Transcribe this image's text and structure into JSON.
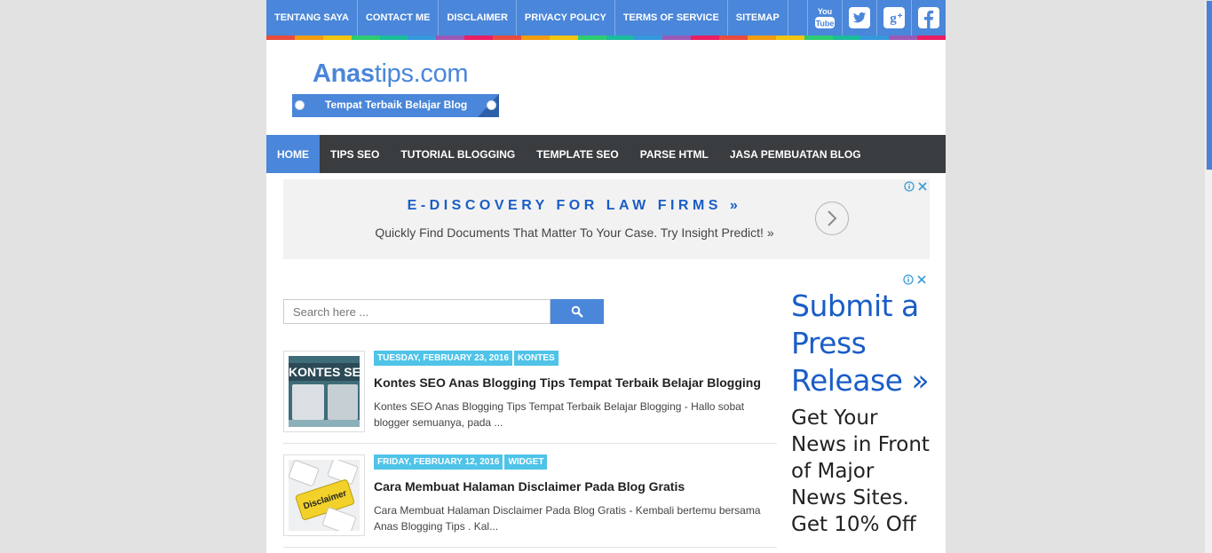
{
  "topnav": {
    "links": [
      "TENTANG SAYA",
      "CONTACT ME",
      "DISCLAIMER",
      "PRIVACY POLICY",
      "TERMS OF SERVICE",
      "SITEMAP"
    ],
    "social": [
      "youtube",
      "twitter",
      "google-plus",
      "facebook"
    ],
    "youtube_label_top": "You",
    "youtube_label_bottom": "Tube"
  },
  "colorbar": [
    "#e84c3d",
    "#f39c12",
    "#f1c40f",
    "#2ecc71",
    "#1abc9c",
    "#3498db",
    "#9b59b6",
    "#e91e63"
  ],
  "header": {
    "logo_bold": "Anas",
    "logo_rest": "tips.com",
    "tagline": "Tempat Terbaik Belajar Blog"
  },
  "mainnav": {
    "items": [
      "HOME",
      "TIPS SEO",
      "TUTORIAL BLOGGING",
      "TEMPLATE SEO",
      "PARSE HTML",
      "JASA PEMBUATAN BLOG"
    ],
    "active": "HOME"
  },
  "ad_banner": {
    "headline": "E-DISCOVERY FOR LAW FIRMS »",
    "subline": "Quickly Find Documents That Matter To Your Case. Try Insight Predict! »"
  },
  "search": {
    "placeholder": "Search here ..."
  },
  "posts": [
    {
      "date": "TUESDAY, FEBRUARY 23, 2016",
      "label": "KONTES",
      "title": "Kontes SEO Anas Blogging Tips Tempat Terbaik Belajar Blogging",
      "snippet": "Kontes SEO Anas Blogging Tips Tempat Terbaik Belajar Blogging - Hallo sobat blogger semuanya, pada ...",
      "thumb_text": "KONTES SEO"
    },
    {
      "date": "FRIDAY, FEBRUARY 12, 2016",
      "label": "WIDGET",
      "title": "Cara Membuat Halaman Disclaimer Pada Blog Gratis",
      "snippet": "Cara Membuat Halaman Disclaimer Pada Blog Gratis - Kembali bertemu bersama Anas Blogging Tips . Kal...",
      "thumb_text": "Disclaimer"
    }
  ],
  "side_ad": {
    "headline": "Submit a Press Release »",
    "body": "Get Your News in Front of Major News Sites. Get 10% Off"
  },
  "colors": {
    "brand_blue": "#4a86d9",
    "nav_dark": "#3a3d40",
    "badge": "#4fc3e8",
    "ad_link": "#1a5dc7"
  }
}
